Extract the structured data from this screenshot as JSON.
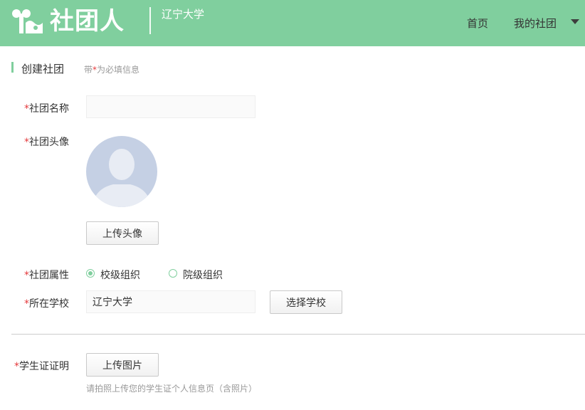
{
  "header": {
    "brand": "社团人",
    "school": "辽宁大学",
    "nav": {
      "home": "首页",
      "my_clubs": "我的社团"
    }
  },
  "section": {
    "title": "创建社团",
    "hint_prefix": "带",
    "hint_mark": "*",
    "hint_suffix": "为必填信息"
  },
  "form": {
    "required_mark": "*",
    "club_name": {
      "label": "社团名称",
      "value": "",
      "placeholder": ""
    },
    "club_avatar": {
      "label": "社团头像",
      "upload_button": "上传头像"
    },
    "club_type": {
      "label": "社团属性",
      "options": [
        "校级组织",
        "院级组织"
      ],
      "selected": "校级组织"
    },
    "school": {
      "label": "所在学校",
      "value": "辽宁大学",
      "select_button": "选择学校"
    },
    "student_id": {
      "label": "学生证证明",
      "upload_button": "上传图片",
      "tip": "请拍照上传您的学生证个人信息页（含照片）"
    }
  },
  "colors": {
    "brand_green": "#80cf9e",
    "required_red": "#e4393c",
    "avatar_bg": "#c5d0e4"
  }
}
